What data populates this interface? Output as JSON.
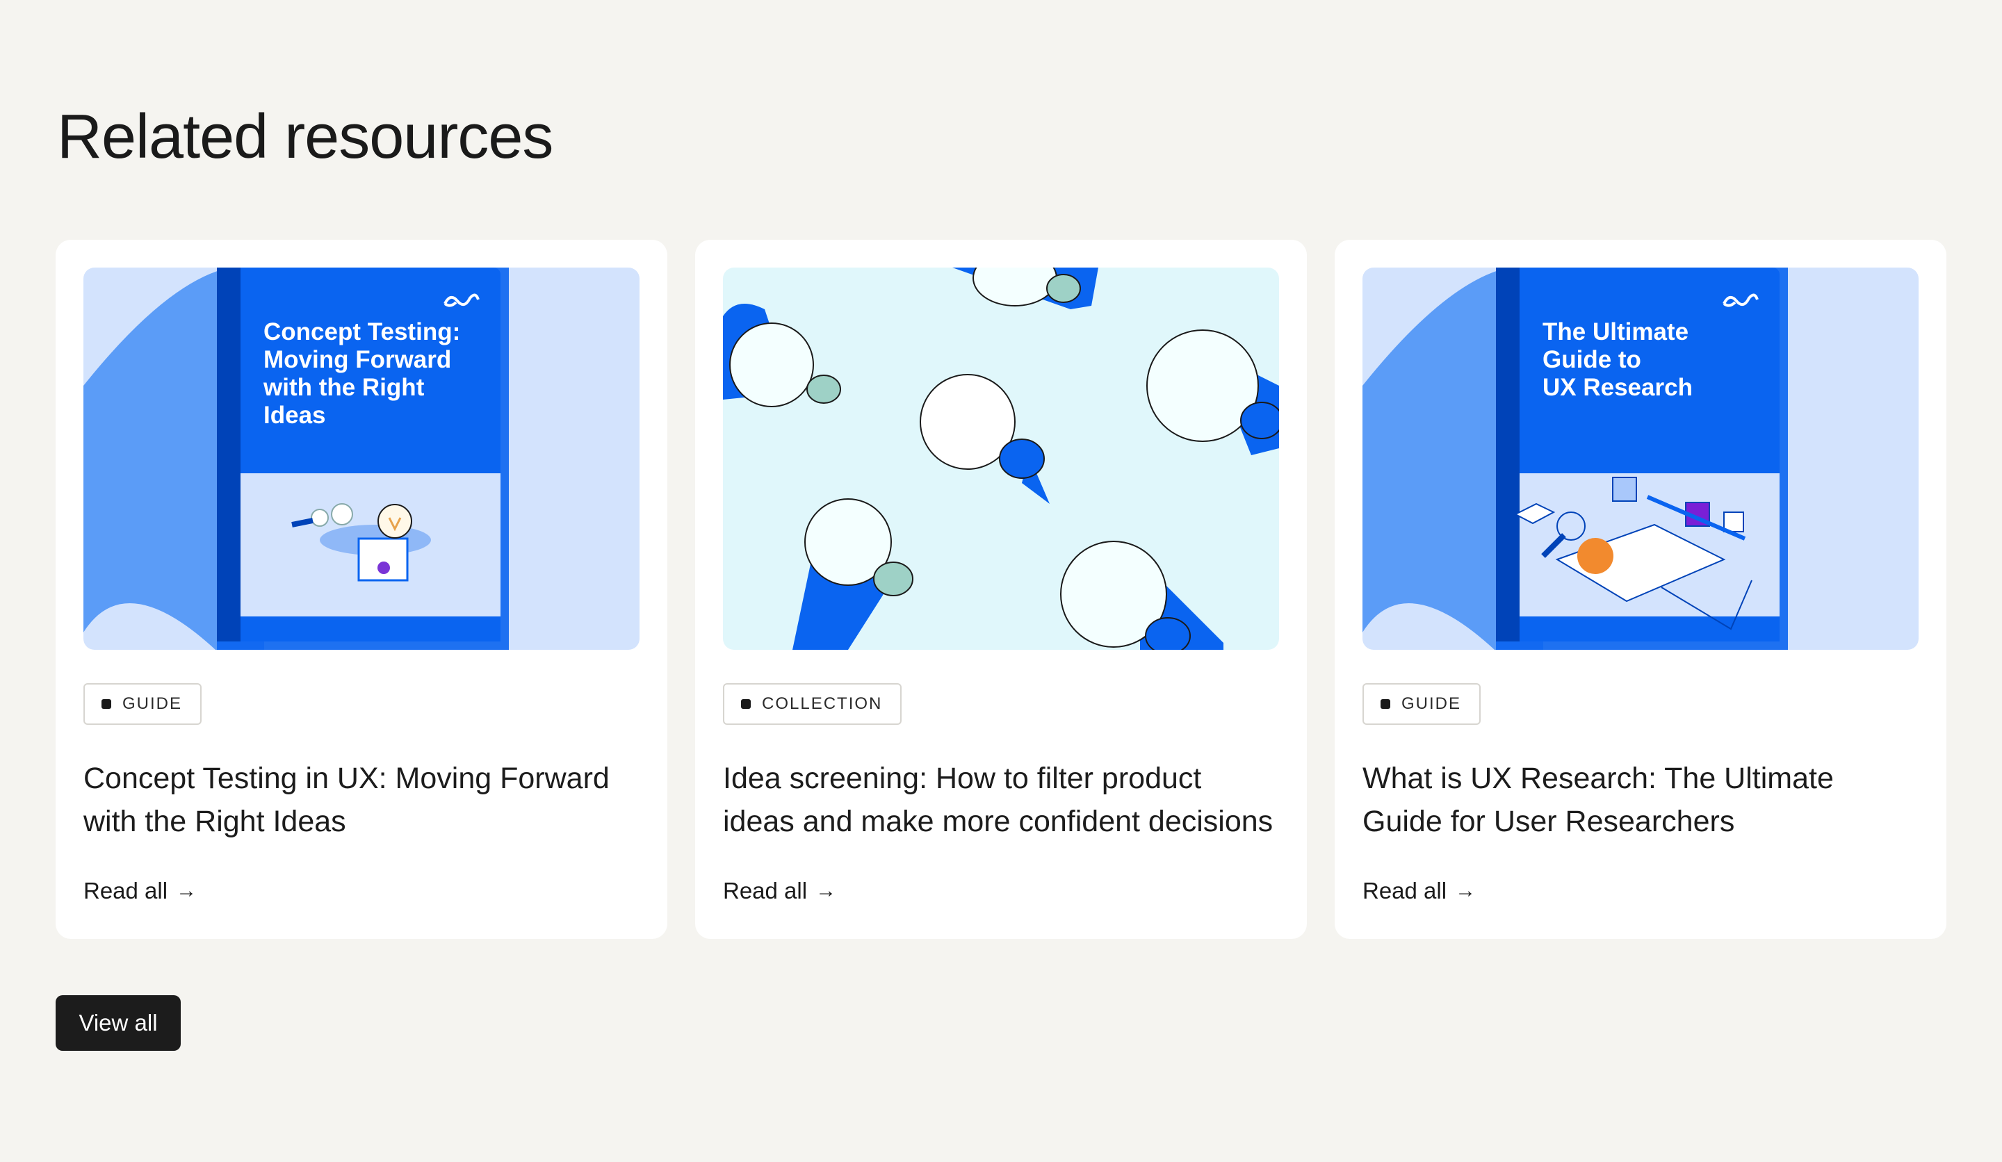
{
  "section": {
    "heading": "Related resources"
  },
  "cards": [
    {
      "tag": "GUIDE",
      "title": "Concept Testing in UX: Moving Forward with the Right Ideas",
      "cover_text": [
        "Concept Testing:",
        "Moving Forward",
        "with the Right",
        "Ideas"
      ],
      "read_label": "Read all",
      "arrow": "→"
    },
    {
      "tag": "COLLECTION",
      "title": "Idea screening: How to filter product ideas and make more confident decisions",
      "read_label": "Read all",
      "arrow": "→"
    },
    {
      "tag": "GUIDE",
      "title": "What is UX Research: The Ultimate Guide for User Researchers",
      "cover_text": [
        "The Ultimate",
        "Guide to",
        "UX Research"
      ],
      "read_label": "Read all",
      "arrow": "→"
    }
  ],
  "view_all_label": "View all",
  "colors": {
    "background": "#f5f4f0",
    "card": "#ffffff",
    "brand_blue": "#0a64f0",
    "light_blue": "#d3e3fd",
    "mid_blue": "#5b9cf7",
    "pale_cyan": "#e0f7fb",
    "button_dark": "#1c1c1c"
  },
  "icons": [
    "brand-logo-icon",
    "arrow-right-icon",
    "tag-square-icon",
    "lightbulb-icon"
  ]
}
